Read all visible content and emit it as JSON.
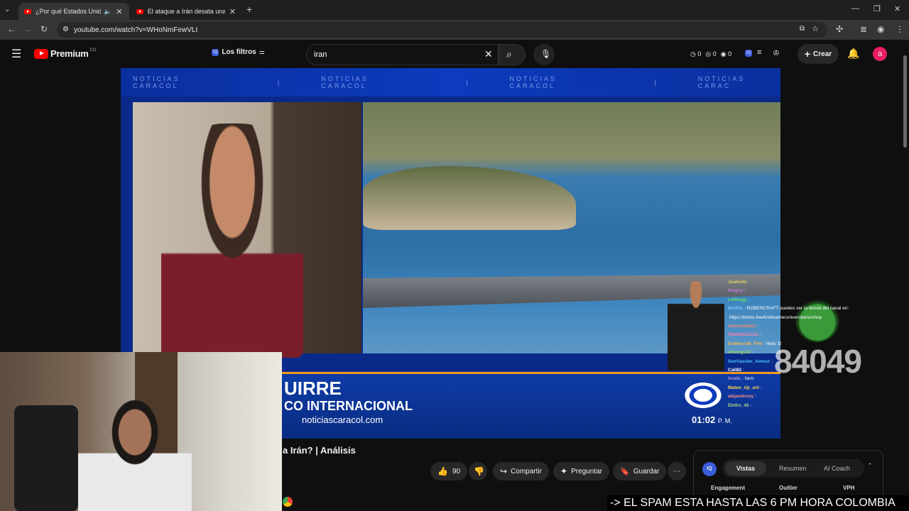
{
  "browser": {
    "tabs": [
      {
        "title": "¿Por qué Estados Unidos e",
        "active": true
      },
      {
        "title": "El ataque a Irán desata una gue",
        "active": false
      }
    ],
    "url": "youtube.com/watch?v=WHoNmFewVLI"
  },
  "youtube": {
    "logo_label": "Premium",
    "logo_region": "CO",
    "filters_label": "Los filtros",
    "search_value": "iran",
    "counters": [
      "0",
      "0",
      "0"
    ],
    "create_label": "Crear",
    "avatar_letter": "a"
  },
  "video": {
    "banner_text": [
      "NOTICIAS CARACOL",
      "|",
      "NOTICIAS CARACOL",
      "|",
      "NOTICIAS CARACOL",
      "|",
      "NOTICIAS CARAC"
    ],
    "lower_third_name": "UIRRE",
    "lower_third_role": "CO INTERNACIONAL",
    "lower_third_site": "noticiascaracol.com",
    "clock": "01:02",
    "clock_suffix": "P. M.",
    "title": "a Irán? | Análisis",
    "overlay_number": "84049"
  },
  "chat": [
    {
      "user": "Juancito",
      "msg": ""
    },
    {
      "user": "fungoy",
      "msg": ":"
    },
    {
      "user": "Lettergg",
      "msg": ":"
    },
    {
      "user": "BotRix",
      "msg": ": ROBERCRAFT puedes ver la tienda del canal en:"
    },
    {
      "user": "",
      "msg": "https://botrix.live/k/streameruniversitario/shop"
    },
    {
      "user": "JesucrackZz",
      "msg": ":"
    },
    {
      "user": "ShadowZzz12",
      "msg": ":"
    },
    {
      "user": "Endercraft_Fire",
      "msg": ": Hola :D"
    },
    {
      "user": "emongus2",
      "msg": ":"
    },
    {
      "user": "SeoYassier_Amour",
      "msg": ":"
    },
    {
      "user": "Cali82",
      "msg": ":"
    },
    {
      "user": "hcaliz",
      "msg": ": farm"
    },
    {
      "user": "Mateo_rip_uni",
      "msg": ":"
    },
    {
      "user": "alejandroxy",
      "msg": ":"
    },
    {
      "user": "Elnfro_40",
      "msg": ":"
    }
  ],
  "actions": {
    "likes": "90",
    "share": "Compartir",
    "ask": "Preguntar",
    "save": "Guardar"
  },
  "vidiq": {
    "badge": "IQ",
    "tabs": [
      "Vistas",
      "Resumen",
      "AI Coach"
    ],
    "columns": [
      "Engagement",
      "Outlier",
      "VPH"
    ]
  },
  "ticker": "-> EL SPAM ESTA HASTA LAS 6 PM HORA COLOMBIA",
  "colors": {
    "yt_red": "#ff0000",
    "caracol_blue": "#0d3bbd",
    "avatar": "#e91e63"
  }
}
